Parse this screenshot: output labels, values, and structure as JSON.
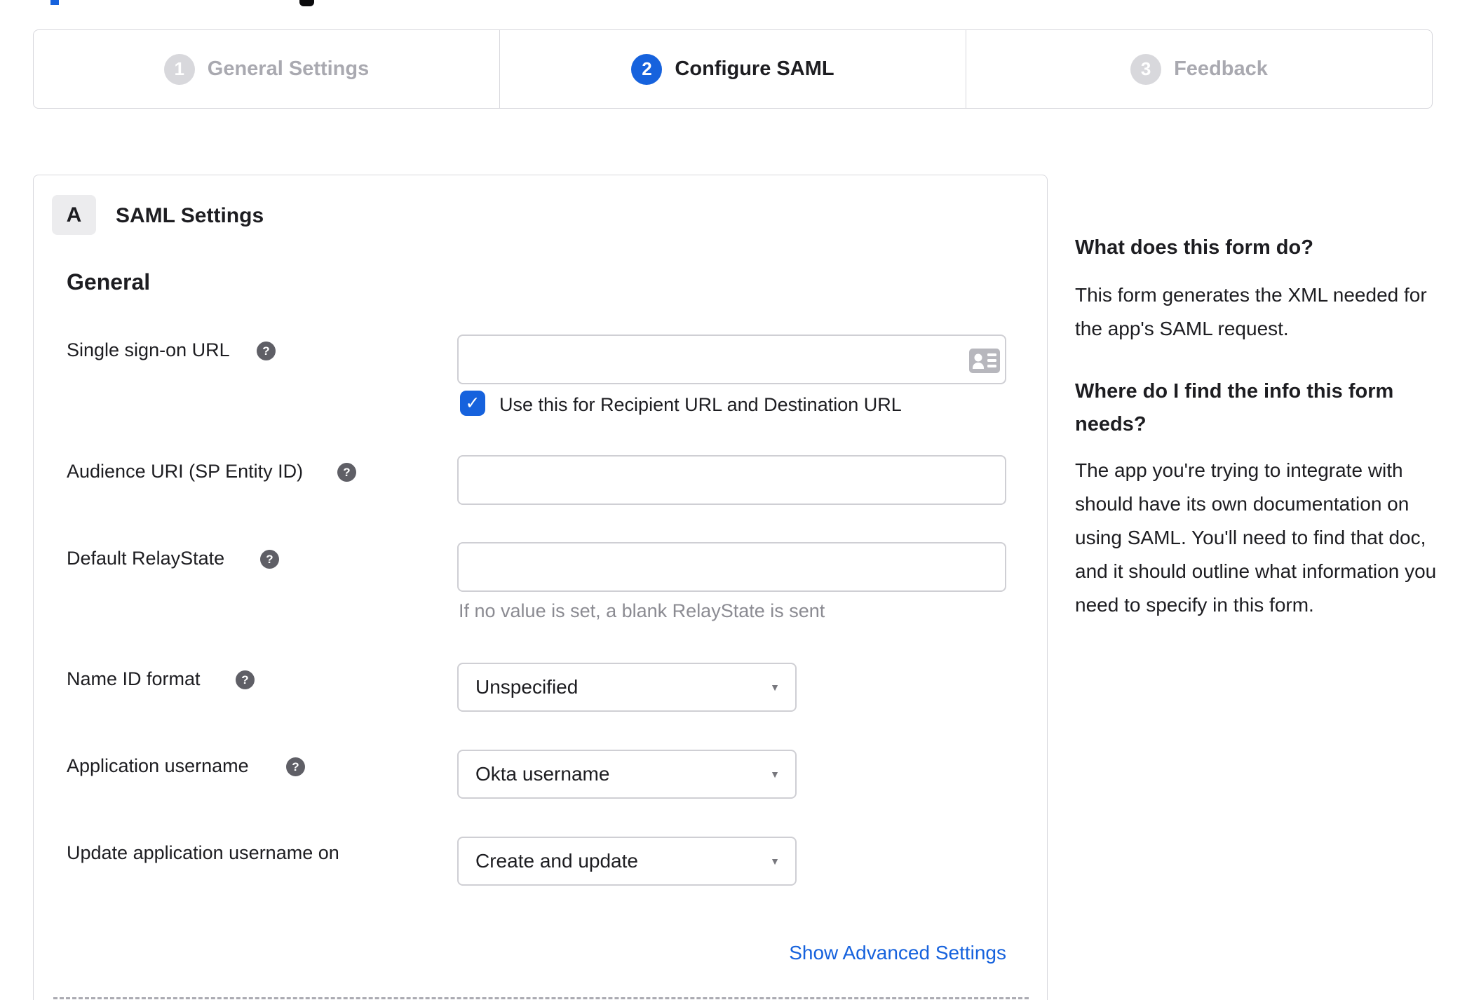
{
  "stepper": {
    "steps": [
      {
        "number": "1",
        "label": "General Settings",
        "state": "inactive"
      },
      {
        "number": "2",
        "label": "Configure SAML",
        "state": "active"
      },
      {
        "number": "3",
        "label": "Feedback",
        "state": "inactive"
      }
    ]
  },
  "panel": {
    "section_badge": "A",
    "section_title": "SAML Settings",
    "group_title": "General",
    "fields": {
      "sso_url": {
        "label": "Single sign-on URL",
        "value": "",
        "checkbox_label": "Use this for Recipient URL and Destination URL",
        "checkbox_checked": true
      },
      "audience_uri": {
        "label": "Audience URI (SP Entity ID)",
        "value": ""
      },
      "default_relaystate": {
        "label": "Default RelayState",
        "value": "",
        "helper": "If no value is set, a blank RelayState is sent"
      },
      "name_id_format": {
        "label": "Name ID format",
        "value": "Unspecified"
      },
      "app_username": {
        "label": "Application username",
        "value": "Okta username"
      },
      "update_app_username": {
        "label": "Update application username on",
        "value": "Create and update"
      }
    },
    "advanced_link": "Show Advanced Settings"
  },
  "sidebar": {
    "sections": [
      {
        "heading": "What does this form do?",
        "body": "This form generates the XML needed for the app's SAML request."
      },
      {
        "heading": "Where do I find the info this form needs?",
        "body": "The app you're trying to integrate with should have its own documentation on using SAML. You'll need to find that doc, and it should outline what information you need to specify in this form."
      }
    ]
  },
  "icons": {
    "help_glyph": "?",
    "checkmark_glyph": "✓",
    "dropdown_arrow_glyph": "▼"
  },
  "colors": {
    "accent_blue": "#1662dd",
    "step_inactive_circle": "#d8d8dc",
    "inactive_text": "#a9a9b0",
    "text_dark": "#1d1d21",
    "helper_gray": "#8b8b92",
    "border_gray": "#d7d7dc",
    "help_icon_bg": "#5f5f66",
    "card_icon_gray": "#b7b7bd"
  }
}
